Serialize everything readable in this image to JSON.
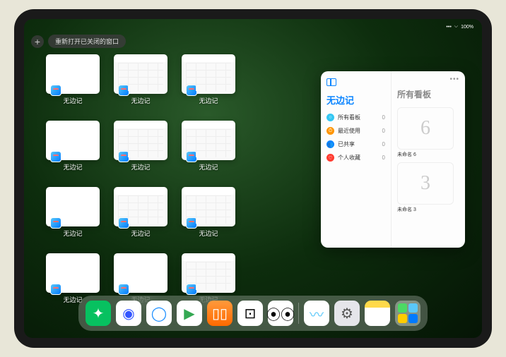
{
  "status": {
    "time": "",
    "signal": "•••",
    "wifi": "⌵",
    "battery": "100%"
  },
  "top_buttons": {
    "close_label": "+",
    "restore_label": "重新打开已关闭的窗口"
  },
  "windows": [
    {
      "label": "无边记",
      "variant": "blank"
    },
    {
      "label": "无边记",
      "variant": "cal"
    },
    {
      "label": "无边记",
      "variant": "cal"
    },
    {
      "label": "无边记",
      "variant": "blank"
    },
    {
      "label": "无边记",
      "variant": "cal"
    },
    {
      "label": "无边记",
      "variant": "cal"
    },
    {
      "label": "无边记",
      "variant": "blank"
    },
    {
      "label": "无边记",
      "variant": "cal"
    },
    {
      "label": "无边记",
      "variant": "cal"
    },
    {
      "label": "无边记",
      "variant": "blank"
    },
    {
      "label": "无边记",
      "variant": "blank"
    },
    {
      "label": "无边记",
      "variant": "cal"
    }
  ],
  "panel": {
    "left_title": "无边记",
    "items": [
      {
        "icon_color": "#34c7f3",
        "glyph": "○",
        "label": "所有看板",
        "count": "0"
      },
      {
        "icon_color": "#ff9500",
        "glyph": "⏱",
        "label": "最近使用",
        "count": "0"
      },
      {
        "icon_color": "#0a84ff",
        "glyph": "👥",
        "label": "已共享",
        "count": "0"
      },
      {
        "icon_color": "#ff3b30",
        "glyph": "♡",
        "label": "个人收藏",
        "count": "0"
      }
    ],
    "right_title": "所有看板",
    "more": "•••",
    "boards": [
      {
        "glyph": "6",
        "label": "未命名 6",
        "sub": ""
      },
      {
        "glyph": "3",
        "label": "未命名 3",
        "sub": ""
      }
    ]
  },
  "dock": {
    "apps": [
      {
        "name": "wechat",
        "bg": "#07c160",
        "glyph": "✦"
      },
      {
        "name": "quark",
        "bg": "#ffffff",
        "glyph": "◉",
        "fg": "#3355ff"
      },
      {
        "name": "qqbrowser",
        "bg": "#ffffff",
        "glyph": "◯",
        "fg": "#1e90ff"
      },
      {
        "name": "play",
        "bg": "#ffffff",
        "glyph": "▶",
        "fg": "#34a853"
      },
      {
        "name": "books",
        "bg": "linear-gradient(#ff9a3c,#ff6a00)",
        "glyph": "▯▯"
      },
      {
        "name": "dice",
        "bg": "#ffffff",
        "glyph": "⊡",
        "fg": "#000"
      },
      {
        "name": "connect",
        "bg": "#ffffff",
        "glyph": "⦿⦿",
        "fg": "#000"
      }
    ],
    "recent": [
      {
        "name": "freeform",
        "bg": "#ffffff",
        "glyph": "〰",
        "fg": "#5ac8fa"
      },
      {
        "name": "settings",
        "bg": "#e5e5ea",
        "glyph": "⚙",
        "fg": "#555"
      },
      {
        "name": "notes",
        "bg": "linear-gradient(#ffd94a 28%,#fff 28%)",
        "glyph": "",
        "fg": "#333"
      }
    ],
    "folder_colors": [
      "#4cd964",
      "#5ac8fa",
      "#ffcc00",
      "#007aff"
    ]
  }
}
